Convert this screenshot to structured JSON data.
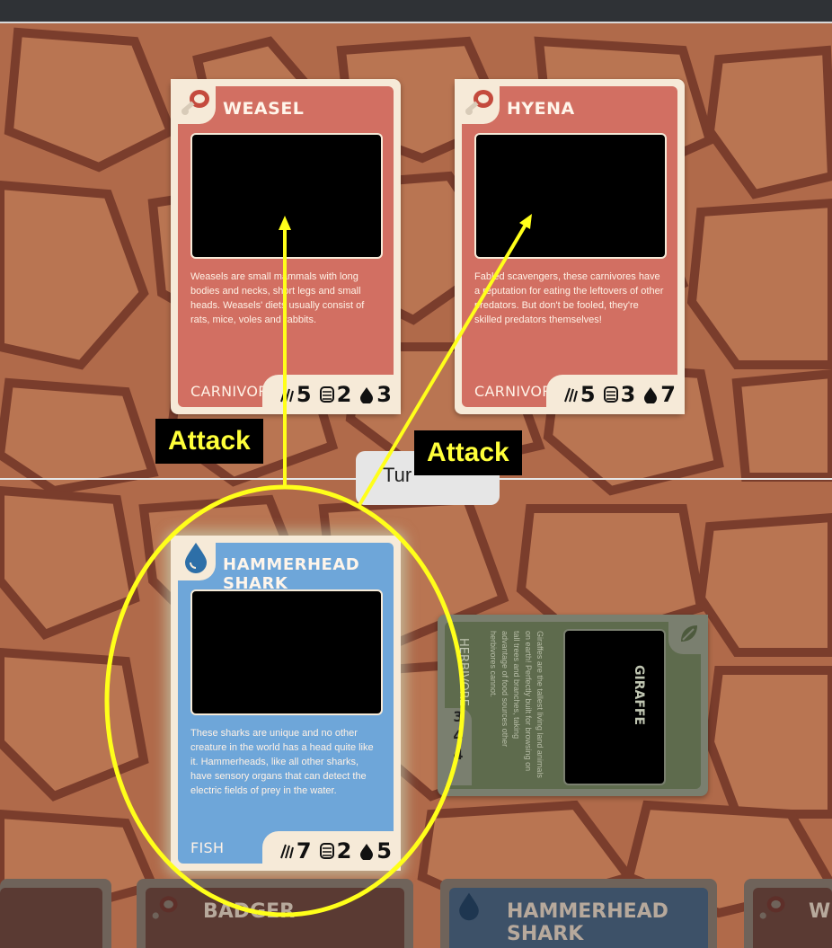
{
  "colors": {
    "carnivore": "#d26f62",
    "fish": "#6ea6d9",
    "herbivore": "#6d7f5b",
    "annotation": "#ffff1a",
    "turn_bg": "#e6e6e6"
  },
  "opponent_cards": [
    {
      "name": "WEASEL",
      "icon": "meat-icon",
      "desc": "Weasels are small mammals with long bodies and necks, short legs and small heads. Weasels' diets usually consist of rats, mice, voles and rabbits.",
      "type": "CARNIVORE",
      "attack": "5",
      "defense": "2",
      "water": "3"
    },
    {
      "name": "HYENA",
      "icon": "meat-icon",
      "desc": "Fabled scavengers, these carnivores have a reputation for eating the leftovers of other predators. But don't be fooled, they're skilled predators themselves!",
      "type": "CARNIVORE",
      "attack": "5",
      "defense": "3",
      "water": "7"
    }
  ],
  "player_cards": [
    {
      "name": "HAMMERHEAD SHARK",
      "icon": "water-drop-icon",
      "desc": "These sharks are unique and no other creature in the world has a head quite like it. Hammerheads, like all other sharks, have sensory organs that can detect the electric fields of prey in the water.",
      "type": "FISH",
      "attack": "7",
      "defense": "2",
      "water": "5"
    },
    {
      "name": "GIRAFFE",
      "icon": "leaf-icon",
      "desc": "Giraffes are the tallest living land animals on earth! Perfectly built for browsing on tall trees and branches, taking advantage of food sources other herbivores cannot.",
      "type": "HERBIVORE",
      "attack": "3",
      "defense": "4",
      "water": "4"
    }
  ],
  "turn_button": {
    "label": "Tur"
  },
  "annotations": {
    "attack_label_1": "Attack",
    "attack_label_2": "Attack"
  },
  "hand": [
    {
      "name": "BADGER",
      "icon": "meat-icon"
    },
    {
      "name": "HAMMERHEAD SHARK",
      "icon": "water-drop-icon"
    },
    {
      "name": "WE",
      "icon": "meat-icon"
    }
  ]
}
